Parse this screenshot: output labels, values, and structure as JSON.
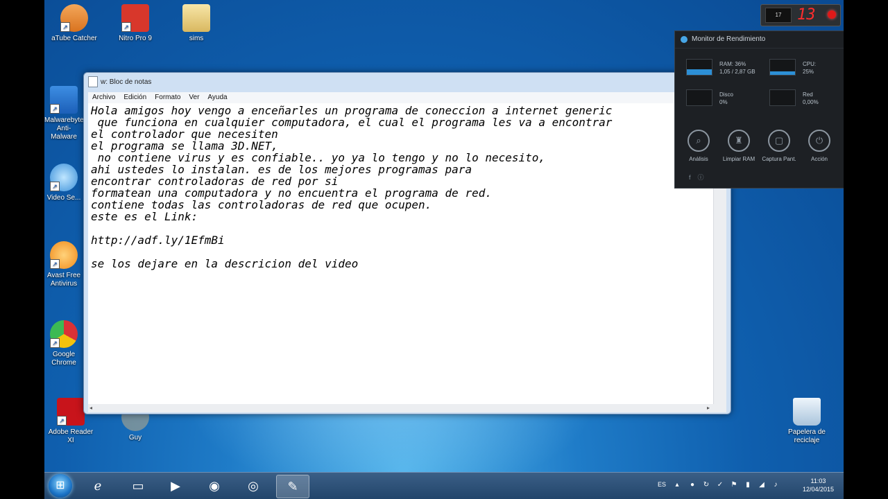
{
  "desktop": {
    "icons": [
      {
        "label": "aTube Catcher",
        "glyph": "🤚"
      },
      {
        "label": "Nitro Pro 9",
        "glyph": "N"
      },
      {
        "label": "sims",
        "glyph": ""
      },
      {
        "label": "Malwarebytes Anti-Malware",
        "glyph": "M"
      },
      {
        "label": "Video Se...",
        "glyph": ""
      },
      {
        "label": "Avast Free Antivirus",
        "glyph": ""
      },
      {
        "label": "Google Chrome",
        "glyph": ""
      },
      {
        "label": "Adobe Reader XI",
        "glyph": "A"
      },
      {
        "label": "Guy",
        "glyph": ""
      },
      {
        "label": "Papelera de reciclaje",
        "glyph": ""
      }
    ]
  },
  "notepad": {
    "title": "w: Bloc de notas",
    "close": "✕",
    "menu": [
      "Archivo",
      "Edición",
      "Formato",
      "Ver",
      "Ayuda"
    ],
    "content": "Hola amigos hoy vengo a enceñarles un programa de coneccion a internet generic\n que funciona en cualquier computadora, el cual el programa les va a encontrar\nel controlador que necesiten\nel programa se llama 3D.NET,\n no contiene virus y es confiable.. yo ya lo tengo y no lo necesito,\nahi ustedes lo instalan. es de los mejores programas para\nencontrar controladoras de red por si\nformatean una computadora y no encuentra el programa de red.\ncontiene todas las controladoras de red que ocupen.\neste es el Link:\n\nhttp://adf.ly/1EfmBi\n\nse los dejare en la descricion del video"
  },
  "monitor": {
    "title": "Monitor de Rendimiento",
    "ram_label": "RAM: 36%",
    "ram_detail": "1,05 / 2,87 GB",
    "ram_percent": 36,
    "cpu_label": "CPU:",
    "cpu_value": "25%",
    "cpu_percent": 25,
    "disk_label": "Disco",
    "disk_value": "0%",
    "disk_percent": 0,
    "net_label": "Red",
    "net_value": "0,00%",
    "net_percent": 0,
    "actions": [
      "Análisis",
      "Limpiar RAM",
      "Captura Pant.",
      "Acción"
    ]
  },
  "recorder": {
    "counter": "13",
    "small_label": "17"
  },
  "taskbar": {
    "language": "ES",
    "time": "11:03",
    "date": "12/04/2015"
  }
}
